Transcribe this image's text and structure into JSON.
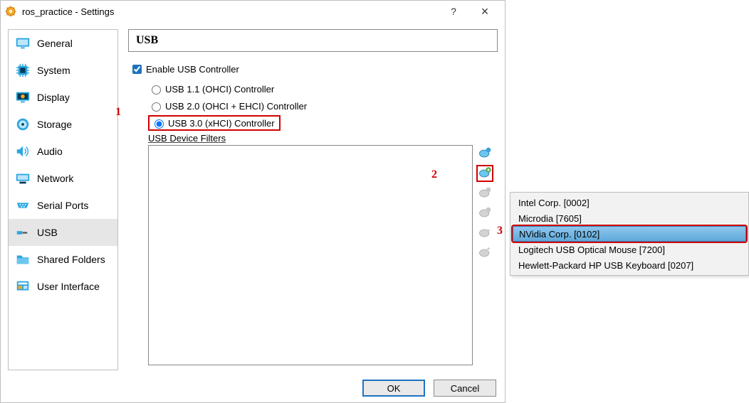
{
  "window": {
    "title": "ros_practice - Settings",
    "help_symbol": "?",
    "close_symbol": "×"
  },
  "sidebar": {
    "items": [
      {
        "label": "General"
      },
      {
        "label": "System"
      },
      {
        "label": "Display"
      },
      {
        "label": "Storage"
      },
      {
        "label": "Audio"
      },
      {
        "label": "Network"
      },
      {
        "label": "Serial Ports"
      },
      {
        "label": "USB"
      },
      {
        "label": "Shared Folders"
      },
      {
        "label": "User Interface"
      }
    ]
  },
  "panel": {
    "title": "USB",
    "enable_label": "Enable USB Controller",
    "radio1": "USB 1.1 (OHCI) Controller",
    "radio2": "USB 2.0 (OHCI + EHCI) Controller",
    "radio3": "USB 3.0 (xHCI) Controller",
    "filters_label": "USB Device Filters"
  },
  "callouts": {
    "c1": "1",
    "c2": "2",
    "c3": "3"
  },
  "popup": {
    "items": [
      {
        "label": "Intel Corp.  [0002]"
      },
      {
        "label": "Microdia  [7605]"
      },
      {
        "label": "NVidia Corp.  [0102]"
      },
      {
        "label": "Logitech USB Optical Mouse [7200]"
      },
      {
        "label": "Hewlett-Packard HP USB Keyboard [0207]"
      }
    ]
  },
  "buttons": {
    "ok": "OK",
    "cancel": "Cancel"
  }
}
